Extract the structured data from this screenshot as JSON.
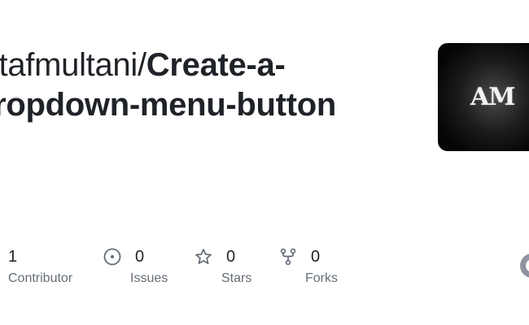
{
  "repo": {
    "owner": "altafmultani",
    "separator": "/",
    "name": "Create-a-dropdown-menu-button"
  },
  "avatar": {
    "monogram": "AM"
  },
  "stats": [
    {
      "icon": "people-icon",
      "count": "1",
      "label": "Contributor"
    },
    {
      "icon": "issue-opened-icon",
      "count": "0",
      "label": "Issues"
    },
    {
      "icon": "star-icon",
      "count": "0",
      "label": "Stars"
    },
    {
      "icon": "repo-forked-icon",
      "count": "0",
      "label": "Forks"
    }
  ],
  "colors": {
    "text": "#1f2328",
    "muted": "#656d76",
    "icon": "#656d76"
  }
}
